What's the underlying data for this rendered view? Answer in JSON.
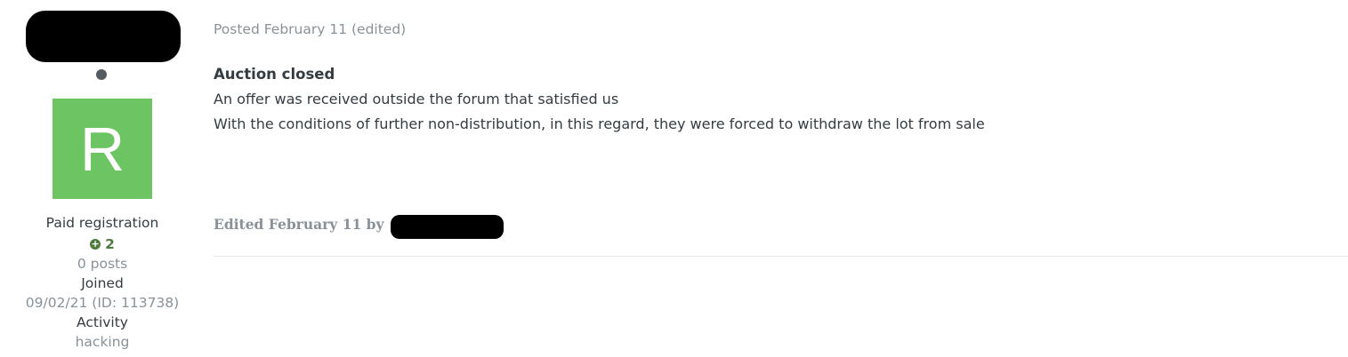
{
  "author": {
    "avatar_letter": "R",
    "avatar_color": "#6cc462",
    "group": "Paid registration",
    "reputation": "2",
    "reputation_icon": "plus-circle-icon",
    "posts": "0 posts",
    "joined_label": "Joined",
    "joined_value": "09/02/21 (ID: 113738)",
    "activity_label": "Activity",
    "activity_value": "hacking"
  },
  "post": {
    "meta": "Posted February 11 (edited)",
    "title": "Auction closed",
    "lines": [
      "An offer was received outside the forum that satisfied us",
      "With the conditions of further non-distribution, in this regard, they were forced to withdraw the lot from sale"
    ],
    "edited_text": "Edited February 11 by"
  }
}
